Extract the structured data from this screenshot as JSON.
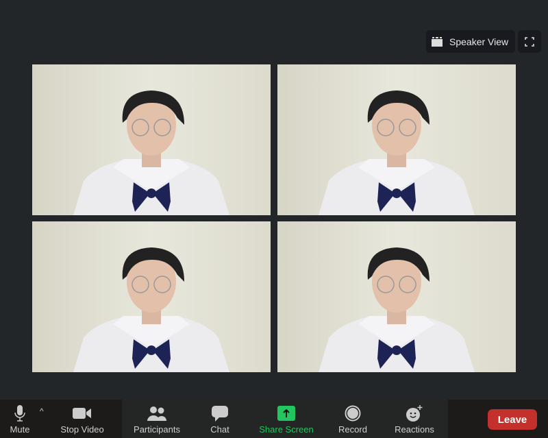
{
  "top": {
    "speaker_view": "Speaker View"
  },
  "tiles": [
    {
      "id": 1
    },
    {
      "id": 2
    },
    {
      "id": 3
    },
    {
      "id": 4
    }
  ],
  "toolbar": {
    "mute": "Mute",
    "stop_video": "Stop Video",
    "participants": "Participants",
    "chat": "Chat",
    "share_screen": "Share Screen",
    "record": "Record",
    "reactions": "Reactions",
    "leave": "Leave"
  },
  "colors": {
    "share": "#22c55e",
    "leave": "#c4302b"
  }
}
